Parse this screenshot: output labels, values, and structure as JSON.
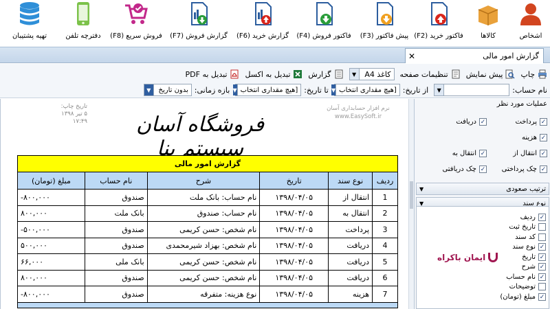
{
  "ribbon": {
    "buttons": [
      {
        "label": "اشخاص",
        "icon": "person-icon"
      },
      {
        "label": "کالاها",
        "icon": "box-icon"
      },
      {
        "label": "فاکتور خرید (F2)",
        "icon": "invoice-upload-icon"
      },
      {
        "label": "پیش فاکتور (F3)",
        "icon": "invoice-download-icon"
      },
      {
        "label": "فاکتور فروش (F4)",
        "icon": "invoice-download-green-icon"
      },
      {
        "label": "گزارش خرید (F6)",
        "icon": "chart-report-icon"
      },
      {
        "label": "گزارش فروش (F7)",
        "icon": "chart-report-down-icon"
      },
      {
        "label": "فروش سریع (F8)",
        "icon": "cart-icon"
      },
      {
        "label": "دفترچه تلفن",
        "icon": "phone-icon"
      },
      {
        "label": "تهیه پشتیبان",
        "icon": "database-icon"
      }
    ]
  },
  "tab": {
    "label": "گزارش امور مالی",
    "close": "✕"
  },
  "toolbar": {
    "print": "چاپ",
    "preview": "پیش نمایش",
    "page_settings": "تنظیمات صفحه",
    "paper": "کاغذ A4",
    "report": "گزارش",
    "to_excel": "تبدیل به اکسل",
    "to_pdf": "تبدیل به PDF",
    "account_label": "نام حساب:",
    "from_date_label": "از تاریخ:",
    "from_date_value": "[هیچ مقداری انتخاب",
    "to_date_label": "تا تاریخ:",
    "to_date_value": "[هیچ مقداری انتخاب",
    "period_label": "بازه زمانی:",
    "period_value": "بدون تاریخ"
  },
  "report": {
    "print_date_label": "تاریخ چاپ:",
    "print_date": "۵ تیر ۱۳۹۸",
    "print_time": "۱۷:۴۹",
    "software_name": "نرم افزار حسابداری آسان",
    "software_site": "www.EasySoft.ir",
    "store_title": "فروشگاه آسان سیستم بنا",
    "table_title": "گزارش امور مالی",
    "columns": [
      "ردیف",
      "نوع سند",
      "تاریخ",
      "شرح",
      "نام حساب",
      "مبلغ (تومان)"
    ],
    "rows": [
      {
        "n": "1",
        "type": "انتقال از",
        "date": "۱۳۹۸/۰۴/۰۵",
        "desc": "نام حساب: بانک ملت",
        "account": "صندوق",
        "amount": "-۸۰۰,۰۰۰"
      },
      {
        "n": "2",
        "type": "انتقال به",
        "date": "۱۳۹۸/۰۴/۰۵",
        "desc": "نام حساب: صندوق",
        "account": "بانک ملت",
        "amount": "۸۰۰,۰۰۰"
      },
      {
        "n": "3",
        "type": "پرداخت",
        "date": "۱۳۹۸/۰۴/۰۵",
        "desc": "نام شخص: حسن کریمی",
        "account": "صندوق",
        "amount": "-۵۰۰,۰۰۰"
      },
      {
        "n": "4",
        "type": "دریافت",
        "date": "۱۳۹۸/۰۴/۰۵",
        "desc": "نام شخص: بهزاد شیرمحمدی",
        "account": "صندوق",
        "amount": "۵۰۰,۰۰۰"
      },
      {
        "n": "5",
        "type": "دریافت",
        "date": "۱۳۹۸/۰۴/۰۵",
        "desc": "نام شخص: حسن کریمی",
        "account": "بانک ملی",
        "amount": "۶۶,۰۰۰"
      },
      {
        "n": "6",
        "type": "دریافت",
        "date": "۱۳۹۸/۰۴/۰۵",
        "desc": "نام شخص: حسن کریمی",
        "account": "صندوق",
        "amount": "۸۰۰,۰۰۰"
      },
      {
        "n": "7",
        "type": "هزینه",
        "date": "۱۳۹۸/۰۴/۰۵",
        "desc": "نوع هزینه: متفرقه",
        "account": "صندوق",
        "amount": "-۸۰۰,۰۰۰"
      }
    ]
  },
  "panel": {
    "ops_title": "عملیات مورد نظر",
    "ops": [
      {
        "label": "پرداخت",
        "checked": true
      },
      {
        "label": "دریافت",
        "checked": true
      },
      {
        "label": "هزینه",
        "checked": true
      },
      {
        "label": "انتقال از",
        "checked": true
      },
      {
        "label": "انتقال به",
        "checked": true
      },
      {
        "label": "چک پرداختی",
        "checked": true
      },
      {
        "label": "چک دریافتی",
        "checked": true
      }
    ],
    "sort_title": "ترتیب صعودی",
    "doc_type_title": "نوع سند",
    "columns": [
      {
        "label": "ردیف",
        "checked": true
      },
      {
        "label": "تاریخ ثبت",
        "checked": false
      },
      {
        "label": "کد سند",
        "checked": false
      },
      {
        "label": "نوع سند",
        "checked": true
      },
      {
        "label": "تاریخ",
        "checked": true
      },
      {
        "label": "شرح",
        "checked": true
      },
      {
        "label": "نام حساب",
        "checked": true
      },
      {
        "label": "توضیحات",
        "checked": false
      },
      {
        "label": "مبلغ (تومان)",
        "checked": true
      }
    ],
    "brand": "ایمان باکراه"
  },
  "colors": {
    "accent": "#2f5ea0",
    "title_yellow": "#ffff00",
    "header_blue": "#bcd9f5",
    "brand": "#a01650"
  }
}
